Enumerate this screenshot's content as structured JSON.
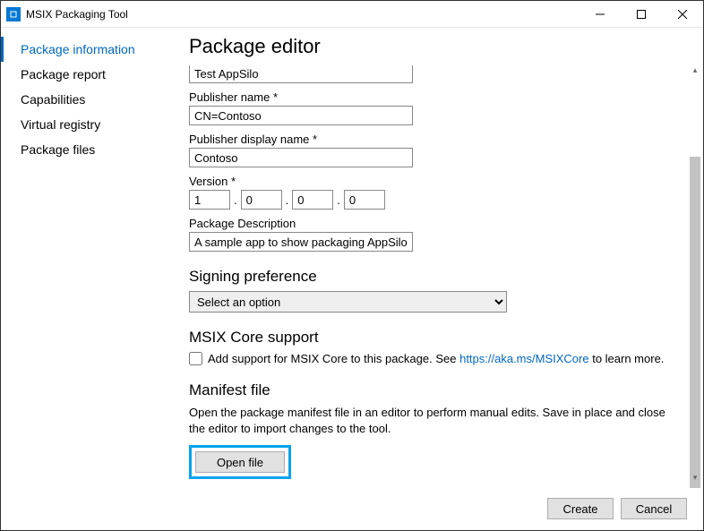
{
  "window": {
    "title": "MSIX Packaging Tool"
  },
  "sidebar": {
    "items": [
      {
        "label": "Package information",
        "selected": true
      },
      {
        "label": "Package report",
        "selected": false
      },
      {
        "label": "Capabilities",
        "selected": false
      },
      {
        "label": "Virtual registry",
        "selected": false
      },
      {
        "label": "Package files",
        "selected": false
      }
    ]
  },
  "page": {
    "title": "Package editor",
    "cut_field_value": "Test AppSilo",
    "publisher_name": {
      "label": "Publisher name *",
      "value": "CN=Contoso"
    },
    "publisher_display_name": {
      "label": "Publisher display name *",
      "value": "Contoso"
    },
    "version": {
      "label": "Version *",
      "parts": [
        "1",
        "0",
        "0",
        "0"
      ]
    },
    "package_description": {
      "label": "Package Description",
      "value": "A sample app to show packaging AppSilo"
    },
    "signing": {
      "heading": "Signing preference",
      "selected": "Select an option"
    },
    "msix_core": {
      "heading": "MSIX Core support",
      "checkbox_label_pre": "Add support for MSIX Core to this package. See ",
      "link_text": "https://aka.ms/MSIXCore",
      "checkbox_label_post": " to learn more."
    },
    "manifest": {
      "heading": "Manifest file",
      "description": "Open the package manifest file in an editor to perform manual edits. Save in place and close the editor to import changes to the tool.",
      "open_button": "Open file"
    }
  },
  "footer": {
    "create": "Create",
    "cancel": "Cancel"
  }
}
